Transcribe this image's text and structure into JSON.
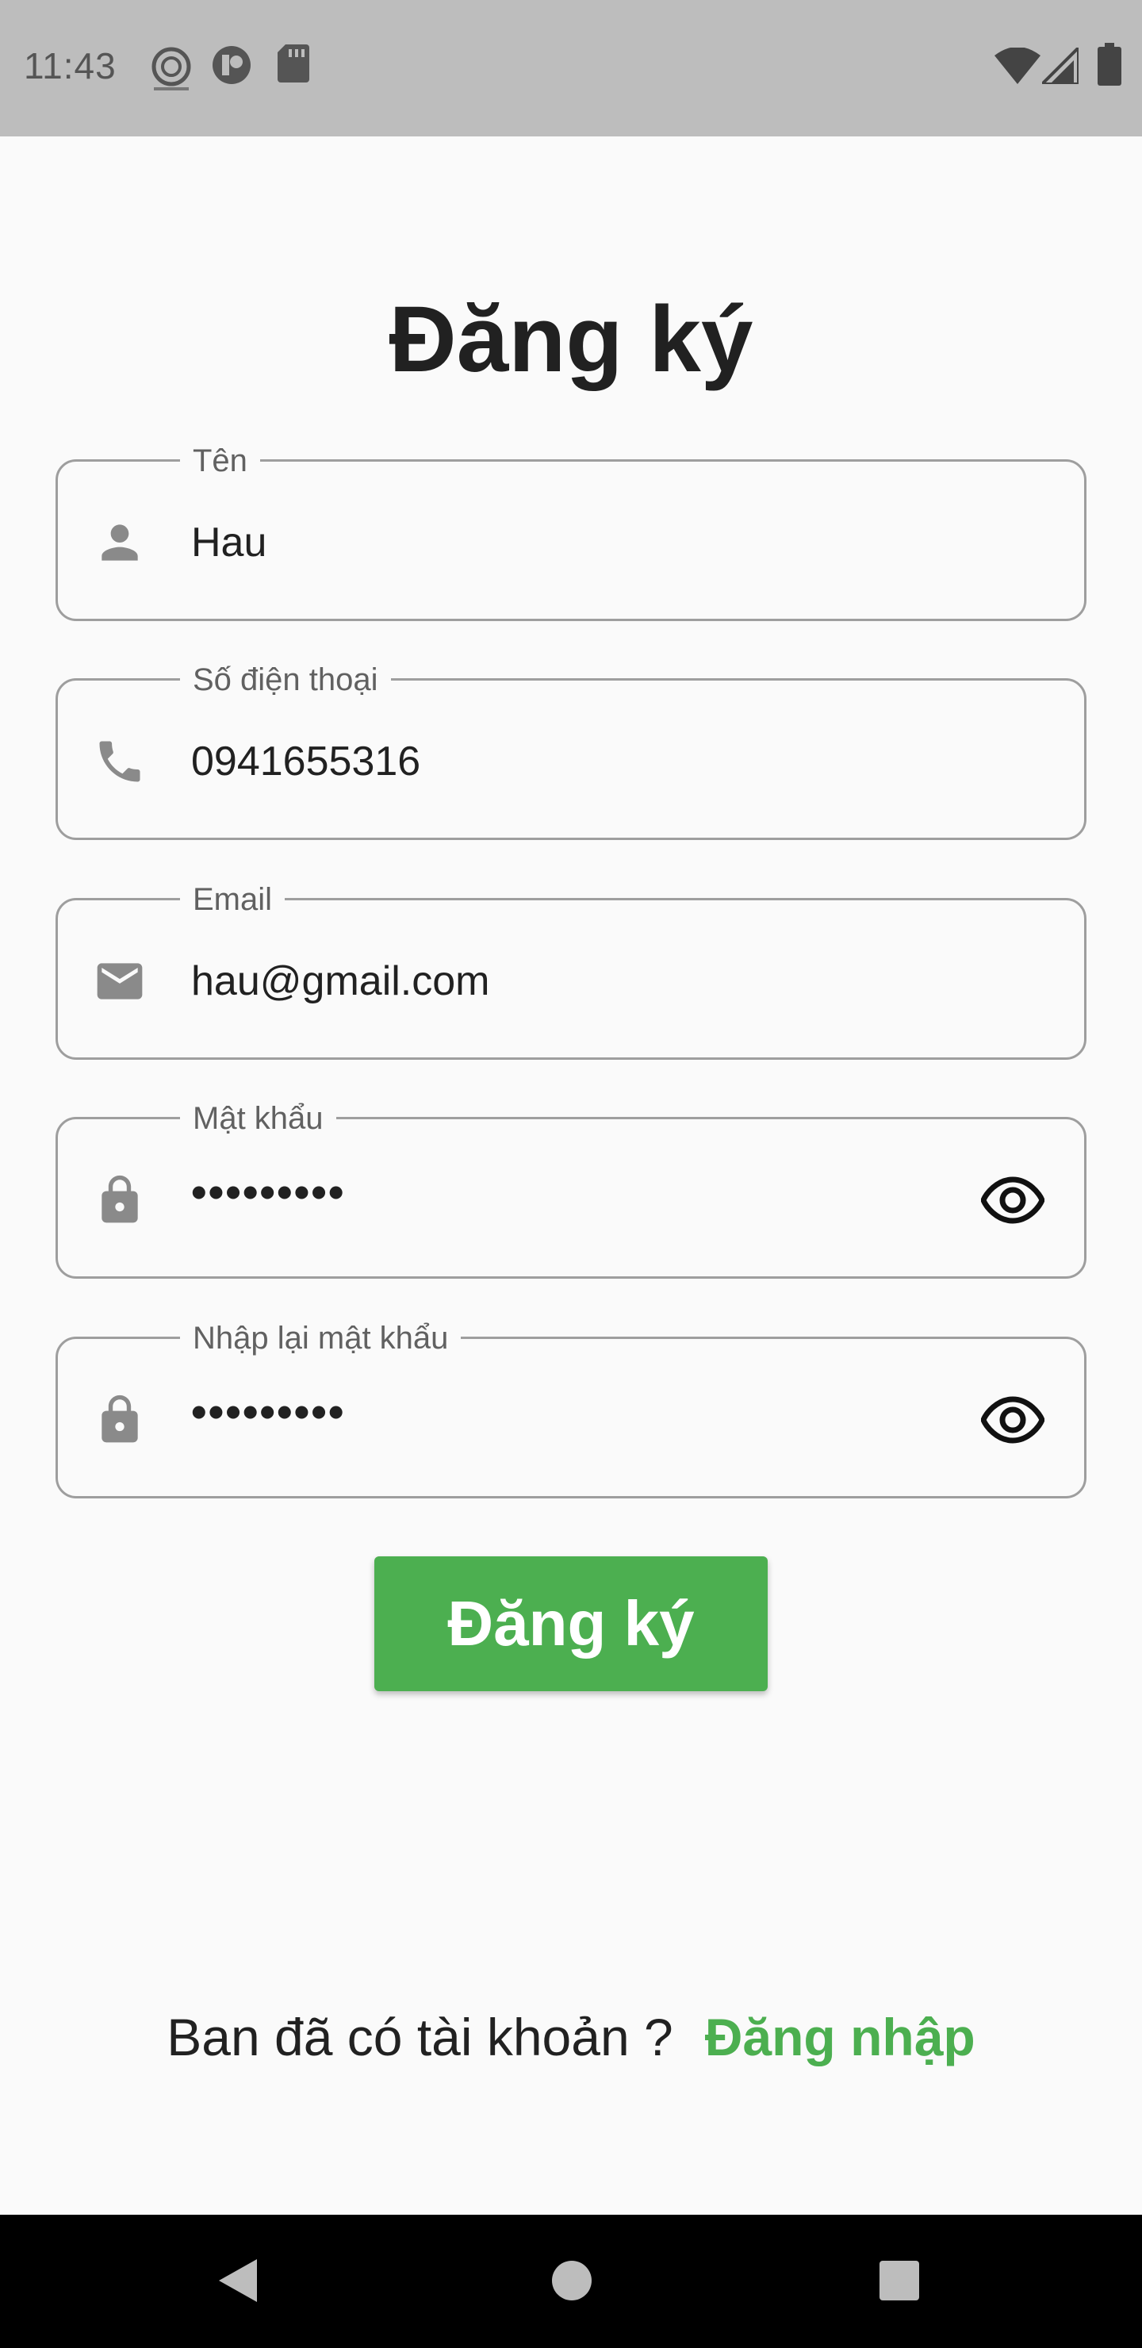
{
  "status_bar": {
    "time": "11:43",
    "icons": [
      "app-logo-icon",
      "media-icon",
      "sd-card-icon",
      "wifi-icon",
      "signal-icon",
      "battery-icon"
    ]
  },
  "title": "Đăng ký",
  "fields": [
    {
      "label": "Tên",
      "value": "Hau",
      "icon": "person-icon"
    },
    {
      "label": "Số điện thoại",
      "value": "0941655316",
      "icon": "phone-icon"
    },
    {
      "label": "Email",
      "value": "hau@gmail.com",
      "icon": "mail-icon"
    },
    {
      "label": "Mật khẩu",
      "value": "•••••••••",
      "icon": "lock-icon",
      "toggle": "eye-icon"
    },
    {
      "label": "Nhập lại mật khẩu",
      "value": "•••••••••",
      "icon": "lock-icon",
      "toggle": "eye-icon"
    }
  ],
  "submit_button": {
    "label": "Đăng ký"
  },
  "footer": {
    "question": "Ban đã có tài khoản ?",
    "link": "Đăng nhập"
  },
  "nav_bar": {
    "buttons": [
      "back-icon",
      "home-icon",
      "recents-icon"
    ]
  },
  "colors": {
    "accent": "#4caf50",
    "status_bar": "#bdbdbd",
    "background": "#fafafa",
    "border": "#9e9e9e"
  }
}
